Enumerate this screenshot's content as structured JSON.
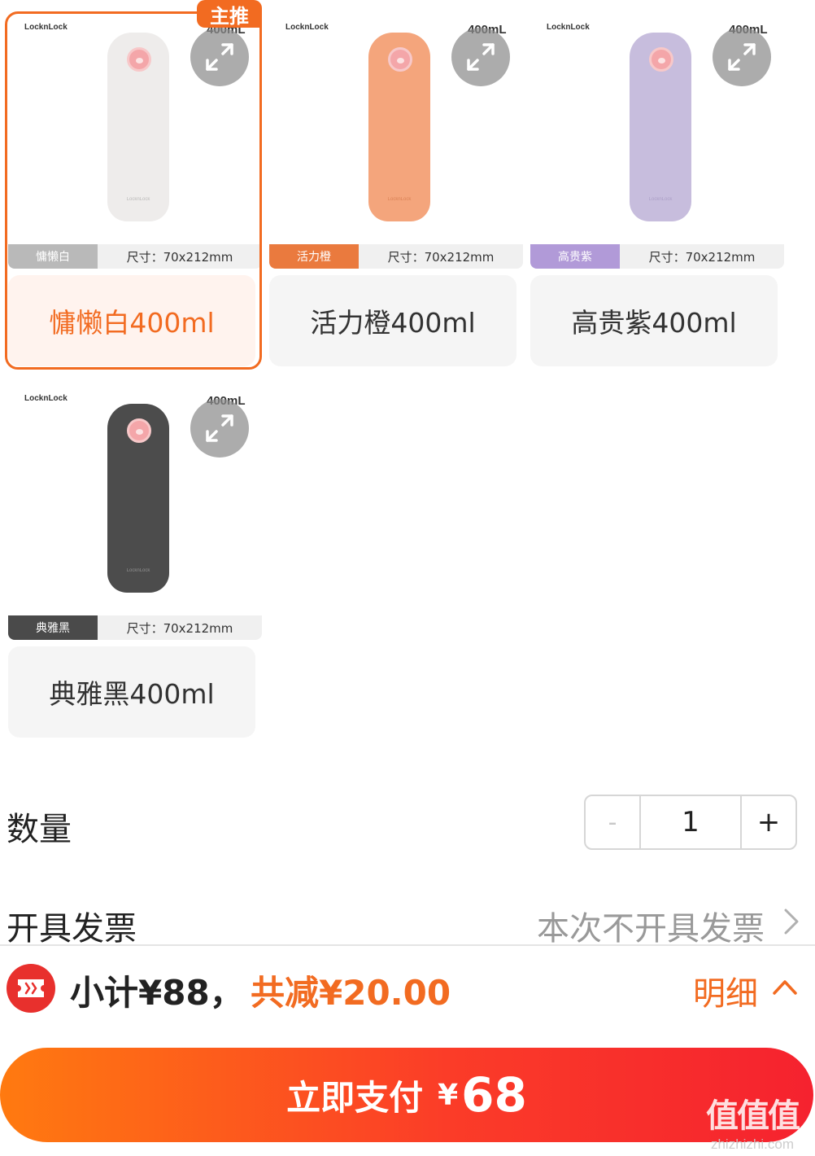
{
  "products": [
    {
      "brand": "LocknLock",
      "capacity_print": "400mL",
      "bottle_logo": "LocknLock",
      "color_tag": "慵懒白",
      "size": "尺寸：70x212mm",
      "option_label": "慵懒白400ml",
      "badge": "主推",
      "selected": true,
      "bottle_color": "#eeeceb",
      "tag_color": "#b9b9b9"
    },
    {
      "brand": "LocknLock",
      "capacity_print": "400mL",
      "bottle_logo": "LocknLock",
      "color_tag": "活力橙",
      "size": "尺寸：70x212mm",
      "option_label": "活力橙400ml",
      "selected": false,
      "bottle_color": "#f4a57c",
      "tag_color": "#ea7a3e"
    },
    {
      "brand": "LocknLock",
      "capacity_print": "400mL",
      "bottle_logo": "LocknLock",
      "color_tag": "高贵紫",
      "size": "尺寸：70x212mm",
      "option_label": "高贵紫400ml",
      "selected": false,
      "bottle_color": "#c7bddd",
      "tag_color": "#b19ad8"
    },
    {
      "brand": "LocknLock",
      "capacity_print": "400mL",
      "bottle_logo": "LocknLock",
      "color_tag": "典雅黑",
      "size": "尺寸：70x212mm",
      "option_label": "典雅黑400ml",
      "selected": false,
      "bottle_color": "#4c4c4c",
      "tag_color": "#4a4a4a"
    }
  ],
  "quantity": {
    "label": "数量",
    "minus": "-",
    "value": "1",
    "plus": "+"
  },
  "invoice": {
    "label": "开具发票",
    "value": "本次不开具发票"
  },
  "summary": {
    "subtotal": "小计¥88，",
    "discount": "共减¥20.00",
    "detail": "明细"
  },
  "pay_button": {
    "label": "立即支付",
    "currency": "¥",
    "amount": "68"
  },
  "watermark": {
    "main": "值值值",
    "sub": "zhizhizhi.com"
  },
  "colors": {
    "accent": "#f26b21",
    "pay_gradient_start": "#ff7a10",
    "pay_gradient_end": "#f5222f"
  }
}
